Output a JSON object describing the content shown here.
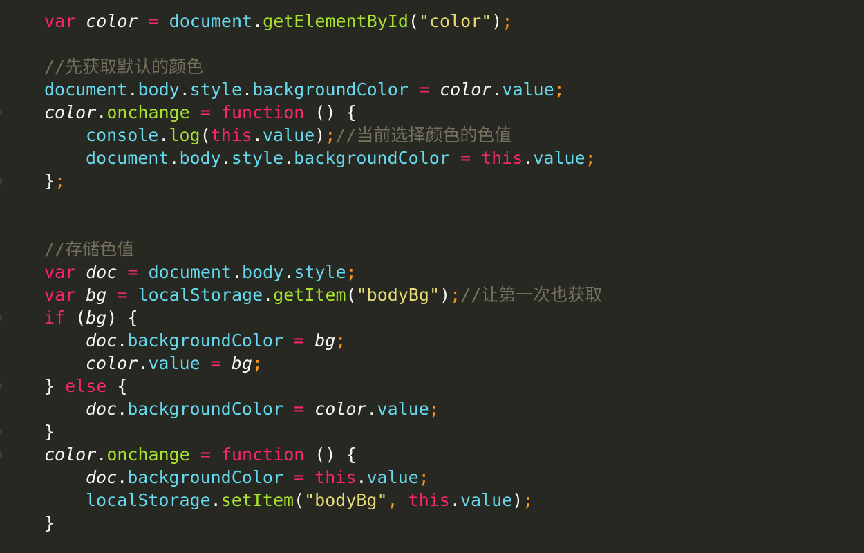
{
  "editor": {
    "theme_colors": {
      "background": "#272822",
      "keyword": "#f92672",
      "object": "#66d9ef",
      "function": "#a6e22e",
      "string": "#e6db74",
      "comment": "#75715e",
      "semicolon": "#fd971f",
      "text": "#f8f8f2"
    },
    "text": {
      "var": "var",
      "color": "color",
      "eq": "=",
      "document": "document",
      "dot": ".",
      "getElementById": "getElementById",
      "lparen": "(",
      "rparen": ")",
      "str_color": "\"color\"",
      "semi": ";",
      "comment_default": "//先获取默认的颜色",
      "body": "body",
      "style": "style",
      "backgroundColor": "backgroundColor",
      "value": "value",
      "onchange": "onchange",
      "function": "function",
      "empty_parens": "()",
      "lbrace": "{",
      "rbrace": "}",
      "console": "console",
      "log": "log",
      "this": "this",
      "comment_current": "//当前选择颜色的色值",
      "comment_store": "//存储色值",
      "doc": "doc",
      "bg": "bg",
      "localStorage": "localStorage",
      "getItem": "getItem",
      "str_bodyBg": "\"bodyBg\"",
      "comment_first": "//让第一次也获取",
      "if": "if",
      "else": "else",
      "setItem": "setItem",
      "comma": ","
    }
  }
}
